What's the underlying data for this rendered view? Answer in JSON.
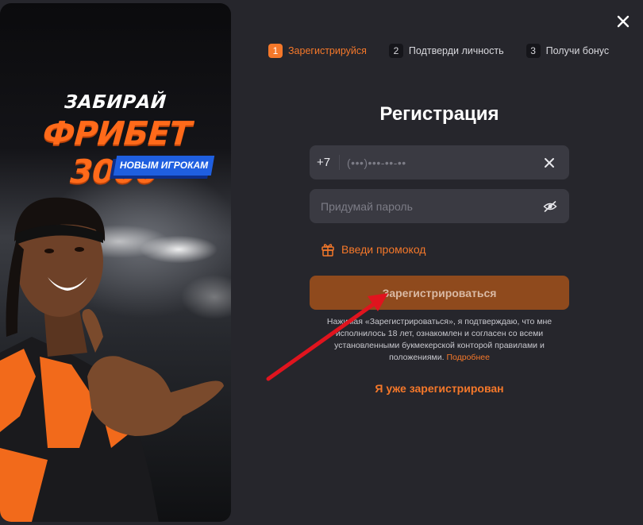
{
  "banner": {
    "line1": "ЗАБИРАЙ",
    "line2": "ФРИБЕТ 3000",
    "badge": "НОВЫМ ИГРОКАМ"
  },
  "steps": [
    {
      "num": "1",
      "label": "Зарегистрируйся",
      "active": true
    },
    {
      "num": "2",
      "label": "Подтверди личность",
      "active": false
    },
    {
      "num": "3",
      "label": "Получи бонус",
      "active": false
    }
  ],
  "form": {
    "title": "Регистрация",
    "phone_code": "+7",
    "phone_placeholder": "(•••)•••-••-••",
    "password_placeholder": "Придумай пароль",
    "promo_label": "Введи промокод",
    "submit_label": "Зарегистрироваться",
    "legal_text": "Нажимая «Зарегистрироваться», я подтверждаю, что мне исполнилось 18 лет, ознакомлен и согласен со всеми установленными букмекерской конторой правилами и положениями.",
    "legal_link": "Подробнее",
    "login_link": "Я уже зарегистрирован"
  },
  "colors": {
    "accent": "#f5782a",
    "background": "#26262c",
    "field": "#3a3a42",
    "submit_disabled": "#8f4a1d",
    "badge": "#1f5fe0",
    "annotation_arrow": "#e0141e"
  },
  "icons": [
    "close-icon",
    "clear-icon",
    "eye-off-icon",
    "gift-icon"
  ]
}
